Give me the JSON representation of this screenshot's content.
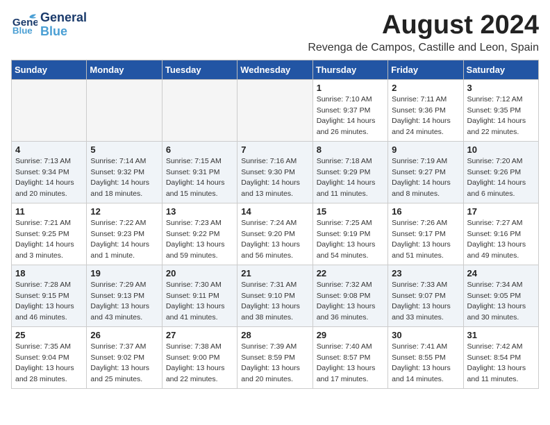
{
  "header": {
    "logo_general": "General",
    "logo_blue": "Blue",
    "title": "August 2024",
    "subtitle": "Revenga de Campos, Castille and Leon, Spain"
  },
  "weekdays": [
    "Sunday",
    "Monday",
    "Tuesday",
    "Wednesday",
    "Thursday",
    "Friday",
    "Saturday"
  ],
  "weeks": [
    [
      {
        "day": "",
        "detail": ""
      },
      {
        "day": "",
        "detail": ""
      },
      {
        "day": "",
        "detail": ""
      },
      {
        "day": "",
        "detail": ""
      },
      {
        "day": "1",
        "detail": "Sunrise: 7:10 AM\nSunset: 9:37 PM\nDaylight: 14 hours\nand 26 minutes."
      },
      {
        "day": "2",
        "detail": "Sunrise: 7:11 AM\nSunset: 9:36 PM\nDaylight: 14 hours\nand 24 minutes."
      },
      {
        "day": "3",
        "detail": "Sunrise: 7:12 AM\nSunset: 9:35 PM\nDaylight: 14 hours\nand 22 minutes."
      }
    ],
    [
      {
        "day": "4",
        "detail": "Sunrise: 7:13 AM\nSunset: 9:34 PM\nDaylight: 14 hours\nand 20 minutes."
      },
      {
        "day": "5",
        "detail": "Sunrise: 7:14 AM\nSunset: 9:32 PM\nDaylight: 14 hours\nand 18 minutes."
      },
      {
        "day": "6",
        "detail": "Sunrise: 7:15 AM\nSunset: 9:31 PM\nDaylight: 14 hours\nand 15 minutes."
      },
      {
        "day": "7",
        "detail": "Sunrise: 7:16 AM\nSunset: 9:30 PM\nDaylight: 14 hours\nand 13 minutes."
      },
      {
        "day": "8",
        "detail": "Sunrise: 7:18 AM\nSunset: 9:29 PM\nDaylight: 14 hours\nand 11 minutes."
      },
      {
        "day": "9",
        "detail": "Sunrise: 7:19 AM\nSunset: 9:27 PM\nDaylight: 14 hours\nand 8 minutes."
      },
      {
        "day": "10",
        "detail": "Sunrise: 7:20 AM\nSunset: 9:26 PM\nDaylight: 14 hours\nand 6 minutes."
      }
    ],
    [
      {
        "day": "11",
        "detail": "Sunrise: 7:21 AM\nSunset: 9:25 PM\nDaylight: 14 hours\nand 3 minutes."
      },
      {
        "day": "12",
        "detail": "Sunrise: 7:22 AM\nSunset: 9:23 PM\nDaylight: 14 hours\nand 1 minute."
      },
      {
        "day": "13",
        "detail": "Sunrise: 7:23 AM\nSunset: 9:22 PM\nDaylight: 13 hours\nand 59 minutes."
      },
      {
        "day": "14",
        "detail": "Sunrise: 7:24 AM\nSunset: 9:20 PM\nDaylight: 13 hours\nand 56 minutes."
      },
      {
        "day": "15",
        "detail": "Sunrise: 7:25 AM\nSunset: 9:19 PM\nDaylight: 13 hours\nand 54 minutes."
      },
      {
        "day": "16",
        "detail": "Sunrise: 7:26 AM\nSunset: 9:17 PM\nDaylight: 13 hours\nand 51 minutes."
      },
      {
        "day": "17",
        "detail": "Sunrise: 7:27 AM\nSunset: 9:16 PM\nDaylight: 13 hours\nand 49 minutes."
      }
    ],
    [
      {
        "day": "18",
        "detail": "Sunrise: 7:28 AM\nSunset: 9:15 PM\nDaylight: 13 hours\nand 46 minutes."
      },
      {
        "day": "19",
        "detail": "Sunrise: 7:29 AM\nSunset: 9:13 PM\nDaylight: 13 hours\nand 43 minutes."
      },
      {
        "day": "20",
        "detail": "Sunrise: 7:30 AM\nSunset: 9:11 PM\nDaylight: 13 hours\nand 41 minutes."
      },
      {
        "day": "21",
        "detail": "Sunrise: 7:31 AM\nSunset: 9:10 PM\nDaylight: 13 hours\nand 38 minutes."
      },
      {
        "day": "22",
        "detail": "Sunrise: 7:32 AM\nSunset: 9:08 PM\nDaylight: 13 hours\nand 36 minutes."
      },
      {
        "day": "23",
        "detail": "Sunrise: 7:33 AM\nSunset: 9:07 PM\nDaylight: 13 hours\nand 33 minutes."
      },
      {
        "day": "24",
        "detail": "Sunrise: 7:34 AM\nSunset: 9:05 PM\nDaylight: 13 hours\nand 30 minutes."
      }
    ],
    [
      {
        "day": "25",
        "detail": "Sunrise: 7:35 AM\nSunset: 9:04 PM\nDaylight: 13 hours\nand 28 minutes."
      },
      {
        "day": "26",
        "detail": "Sunrise: 7:37 AM\nSunset: 9:02 PM\nDaylight: 13 hours\nand 25 minutes."
      },
      {
        "day": "27",
        "detail": "Sunrise: 7:38 AM\nSunset: 9:00 PM\nDaylight: 13 hours\nand 22 minutes."
      },
      {
        "day": "28",
        "detail": "Sunrise: 7:39 AM\nSunset: 8:59 PM\nDaylight: 13 hours\nand 20 minutes."
      },
      {
        "day": "29",
        "detail": "Sunrise: 7:40 AM\nSunset: 8:57 PM\nDaylight: 13 hours\nand 17 minutes."
      },
      {
        "day": "30",
        "detail": "Sunrise: 7:41 AM\nSunset: 8:55 PM\nDaylight: 13 hours\nand 14 minutes."
      },
      {
        "day": "31",
        "detail": "Sunrise: 7:42 AM\nSunset: 8:54 PM\nDaylight: 13 hours\nand 11 minutes."
      }
    ]
  ]
}
